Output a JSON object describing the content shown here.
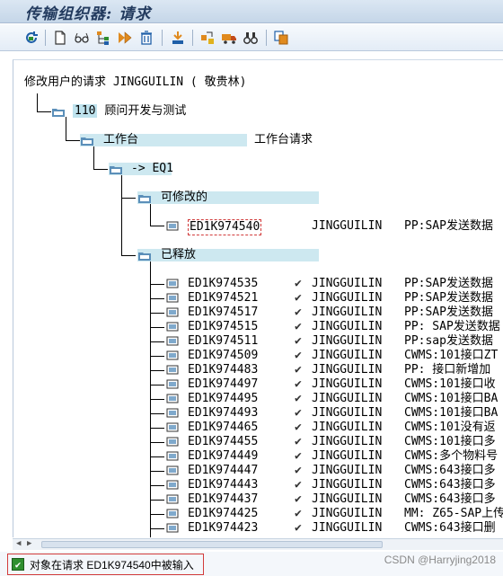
{
  "window": {
    "title": "传输组织器: 请求"
  },
  "toolbar": {
    "buttons": [
      {
        "name": "refresh",
        "icon": "refresh-icon"
      },
      {
        "name": "create",
        "icon": "new-document-icon"
      },
      {
        "name": "display-change",
        "icon": "glasses-icon"
      },
      {
        "name": "hierarchy",
        "icon": "hierarchy-icon"
      },
      {
        "name": "execute",
        "icon": "execute-icon"
      },
      {
        "name": "delete",
        "icon": "trash-icon"
      },
      {
        "name": "release",
        "icon": "release-icon"
      },
      {
        "name": "merge",
        "icon": "merge-icon"
      },
      {
        "name": "transport",
        "icon": "truck-icon"
      },
      {
        "name": "find",
        "icon": "binoculars-icon"
      },
      {
        "name": "copy",
        "icon": "copy-icon"
      }
    ]
  },
  "tree": {
    "root_label": "修改用户的请求 JINGGUILIN ( 敬贵林)",
    "client": {
      "number": "110",
      "label": "顾问开发与测试"
    },
    "workbench": {
      "label": "工作台",
      "desc": "工作台请求"
    },
    "target": {
      "label": "-> EQ1"
    },
    "modifiable": {
      "label": "可修改的",
      "items": [
        {
          "id": "ED1K974540",
          "user": "JINGGUILIN",
          "desc": "PP:SAP发送数据"
        }
      ]
    },
    "released": {
      "label": "已释放",
      "check": "✔",
      "items": [
        {
          "id": "ED1K974535",
          "user": "JINGGUILIN",
          "desc": "PP:SAP发送数据"
        },
        {
          "id": "ED1K974521",
          "user": "JINGGUILIN",
          "desc": "PP:SAP发送数据"
        },
        {
          "id": "ED1K974517",
          "user": "JINGGUILIN",
          "desc": "PP:SAP发送数据"
        },
        {
          "id": "ED1K974515",
          "user": "JINGGUILIN",
          "desc": "PP: SAP发送数据"
        },
        {
          "id": "ED1K974511",
          "user": "JINGGUILIN",
          "desc": "PP:sap发送数据"
        },
        {
          "id": "ED1K974509",
          "user": "JINGGUILIN",
          "desc": "CWMS:101接口ZT"
        },
        {
          "id": "ED1K974483",
          "user": "JINGGUILIN",
          "desc": "PP: 接口新增加"
        },
        {
          "id": "ED1K974497",
          "user": "JINGGUILIN",
          "desc": "CWMS:101接口收"
        },
        {
          "id": "ED1K974495",
          "user": "JINGGUILIN",
          "desc": "CWMS:101接口BA"
        },
        {
          "id": "ED1K974493",
          "user": "JINGGUILIN",
          "desc": "CWMS:101接口BA"
        },
        {
          "id": "ED1K974465",
          "user": "JINGGUILIN",
          "desc": "CWMS:101没有返"
        },
        {
          "id": "ED1K974455",
          "user": "JINGGUILIN",
          "desc": "CWMS:101接口多"
        },
        {
          "id": "ED1K974449",
          "user": "JINGGUILIN",
          "desc": "CWMS:多个物料号"
        },
        {
          "id": "ED1K974447",
          "user": "JINGGUILIN",
          "desc": "CWMS:643接口多"
        },
        {
          "id": "ED1K974443",
          "user": "JINGGUILIN",
          "desc": "CWMS:643接口多"
        },
        {
          "id": "ED1K974437",
          "user": "JINGGUILIN",
          "desc": "CWMS:643接口多"
        },
        {
          "id": "ED1K974425",
          "user": "JINGGUILIN",
          "desc": "MM: Z65-SAP上传"
        },
        {
          "id": "ED1K974423",
          "user": "JINGGUILIN",
          "desc": "CWMS:643接口删"
        }
      ]
    }
  },
  "status": {
    "icon": "ok-check-icon",
    "check": "✔",
    "message": "对象在请求 ED1K974540中被输入"
  },
  "watermark": "CSDN @Harryjing2018",
  "colors": {
    "highlight": "#cde8f0",
    "folder": "#5b8fb9",
    "status_border": "#d23b3b"
  }
}
